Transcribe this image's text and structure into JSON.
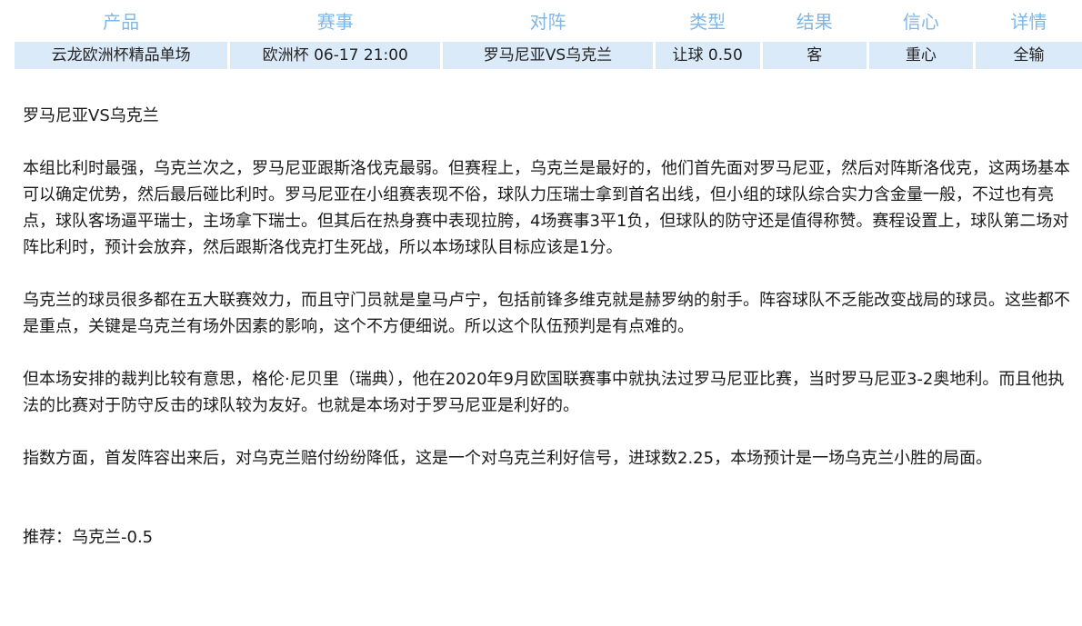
{
  "table": {
    "headers": [
      "产品",
      "赛事",
      "对阵",
      "类型",
      "结果",
      "信心",
      "详情"
    ],
    "row": {
      "product": "云龙欧洲杯精品单场",
      "event": "欧洲杯 06-17 21:00",
      "match": "罗马尼亚VS乌克兰",
      "type": "让球 0.50",
      "result": "客",
      "confidence": "重心",
      "detail": "全输"
    }
  },
  "article": {
    "title": "罗马尼亚VS乌克兰",
    "paragraphs": [
      "本组比利时最强，乌克兰次之，罗马尼亚跟斯洛伐克最弱。但赛程上，乌克兰是最好的，他们首先面对罗马尼亚，然后对阵斯洛伐克，这两场基本可以确定优势，然后最后碰比利时。罗马尼亚在小组赛表现不俗，球队力压瑞士拿到首名出线，但小组的球队综合实力含金量一般，不过也有亮点，球队客场逼平瑞士，主场拿下瑞士。但其后在热身赛中表现拉胯，4场赛事3平1负，但球队的防守还是值得称赞。赛程设置上，球队第二场对阵比利时，预计会放弃，然后跟斯洛伐克打生死战，所以本场球队目标应该是1分。",
      "乌克兰的球员很多都在五大联赛效力，而且守门员就是皇马卢宁，包括前锋多维克就是赫罗纳的射手。阵容球队不乏能改变战局的球员。这些都不是重点，关键是乌克兰有场外因素的影响，这个不方便细说。所以这个队伍预判是有点难的。",
      "但本场安排的裁判比较有意思，格伦·尼贝里（瑞典），他在2020年9月欧国联赛事中就执法过罗马尼亚比赛，当时罗马尼亚3-2奥地利。而且他执法的比赛对于防守反击的球队较为友好。也就是本场对于罗马尼亚是利好的。",
      "指数方面，首发阵容出来后，对乌克兰赔付纷纷降低，这是一个对乌克兰利好信号，进球数2.25，本场预计是一场乌克兰小胜的局面。"
    ],
    "recommendation": "推荐：乌克兰-0.5"
  }
}
